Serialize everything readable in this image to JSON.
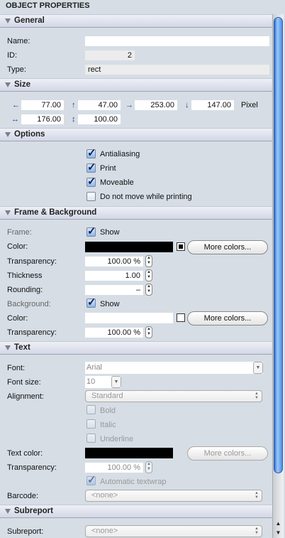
{
  "title": "OBJECT PROPERTIES",
  "sections": {
    "general": "General",
    "size": "Size",
    "options": "Options",
    "frame": "Frame & Background",
    "text": "Text",
    "subreport": "Subreport"
  },
  "general": {
    "name_label": "Name:",
    "name_value": "",
    "id_label": "ID:",
    "id_value": "2",
    "type_label": "Type:",
    "type_value": "rect"
  },
  "size": {
    "left": "77.00",
    "top": "47.00",
    "right": "253.00",
    "bottom": "147.00",
    "unit": "Pixel",
    "width": "176.00",
    "height": "100.00"
  },
  "options": {
    "antialiasing": "Antialiasing",
    "print": "Print",
    "moveable": "Moveable",
    "no_move": "Do not move while printing"
  },
  "frame": {
    "frame_label": "Frame:",
    "show": "Show",
    "color_label": "Color:",
    "more_colors": "More colors...",
    "transparency_label": "Transparency:",
    "transparency": "100.00 %",
    "thickness_label": "Thickness",
    "thickness": "1.00",
    "rounding_label": "Rounding:",
    "rounding": "–",
    "background_label": "Background:",
    "bg_show": "Show",
    "bg_color_label": "Color:",
    "bg_more_colors": "More colors...",
    "bg_transparency_label": "Transparency:",
    "bg_transparency": "100.00 %",
    "frame_color": "#000000",
    "bg_color": "#ffffff"
  },
  "text": {
    "font_label": "Font:",
    "font": "Arial",
    "font_size_label": "Font size:",
    "font_size": "10",
    "alignment_label": "Alignment:",
    "alignment": "Standard",
    "bold": "Bold",
    "italic": "Italic",
    "underline": "Underline",
    "text_color_label": "Text color:",
    "more_colors": "More colors...",
    "transparency_label": "Transparency:",
    "transparency": "100.00 %",
    "autowrap": "Automatic textwrap",
    "barcode_label": "Barcode:",
    "barcode": "<none>"
  },
  "subreport": {
    "label": "Subreport:",
    "value": "<none>"
  }
}
